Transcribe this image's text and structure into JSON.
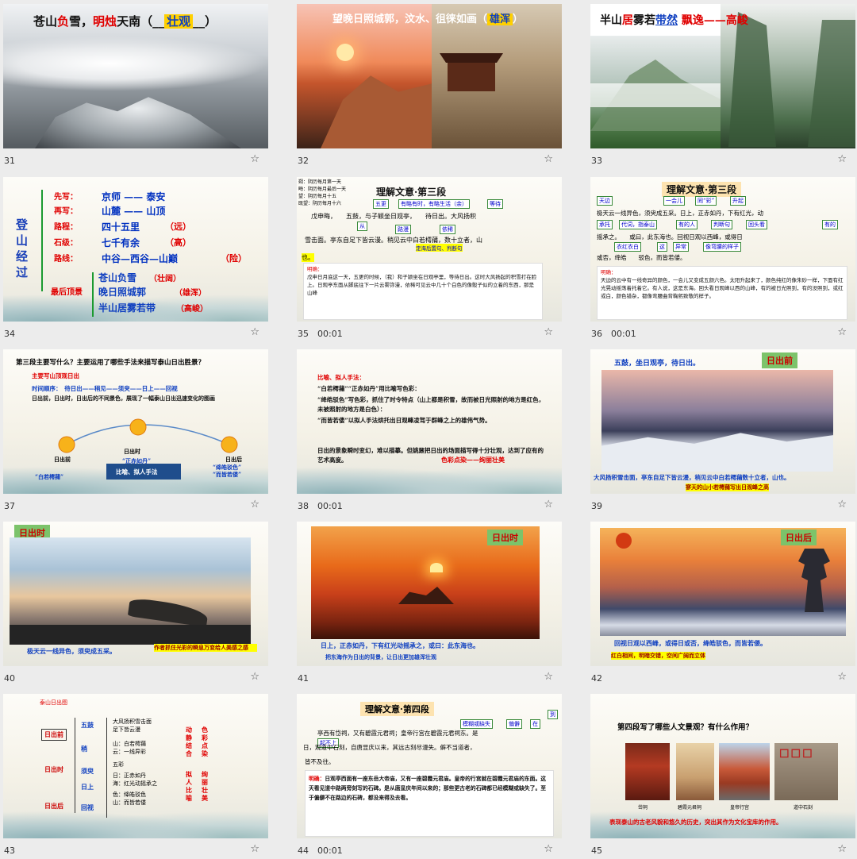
{
  "slides": [
    {
      "num": "31",
      "dur": "",
      "title_pre": "苍山",
      "title_red": "负",
      "title_mid": "雪，",
      "title_red2": "明烛",
      "title_post": "天南（__",
      "title_box": "壮观",
      "title_end": "__）"
    },
    {
      "num": "32",
      "dur": "",
      "title_pre": "望晚日照城郭，汶水、徂徕如画（",
      "title_box": "雄浑",
      "title_end": "）"
    },
    {
      "num": "33",
      "dur": "",
      "title_pre": "半山",
      "title_red": "居",
      "title_mid": "雾若",
      "title_ul": "带然",
      "title_gap": "   ",
      "title_red2": "飘逸——高峻"
    },
    {
      "num": "34",
      "dur": "",
      "side": "登山经过",
      "rows": [
        {
          "label": "先写：",
          "value": "京师 —— 泰安"
        },
        {
          "label": "再写：",
          "value": "山麓 —— 山顶"
        },
        {
          "label": "路程：",
          "value": "四十五里",
          "note": "（远）"
        },
        {
          "label": "石级：",
          "value": "七千有余",
          "note": "（高）"
        },
        {
          "label": "路线：",
          "value": "中谷—西谷—山巅",
          "note": "（险）"
        }
      ],
      "last_label": "最后顶景",
      "scenes": [
        {
          "text": "苍山负雪",
          "note": "（壮阔）"
        },
        {
          "text": "晚日照城郭",
          "note": "（雄浑）"
        },
        {
          "text": "半山居雾若带",
          "note": "（高峻）"
        }
      ]
    },
    {
      "num": "35",
      "dur": "00:01",
      "header": "理解文意·第三段",
      "notes_left": [
        "朔：阴历每月第一天",
        "晦：阴历每月最后一天",
        "望：阴历每月十五",
        "既望：阴历每月十六"
      ],
      "tags": [
        "五更",
        "有略有时，有略生活（余）",
        "等待",
        "从",
        "路漫",
        "依稀"
      ],
      "line1": "戊申晦，　　五鼓，与子颖坐日观亭，　　待日出。大风扬积",
      "line2": "雪击面。亭东自足下皆云漫。稍见云中白若樗蒱，数十立者，山",
      "line2b": "定海后置句、判断句",
      "line3": "也。",
      "expl_label": "明确：",
      "expl": "戊申日月底这一天，五更的时候，（我）和子颖坐在日观亭里，等待日出。这时大风扬起的积雪打在脸上。日观亭东面从脚底往下一片云雾弥漫，依稀可见云中几十个白色的像骰子似的立着的东西，那是山峰"
    },
    {
      "num": "36",
      "dur": "00:01",
      "header": "理解文意·第三段",
      "tags": [
        "天边",
        "一会儿",
        "同“彩”",
        "升起",
        "承托",
        "代词，指泰山",
        "有的人",
        "判断句",
        "回头看",
        "有的",
        "衣红衣白",
        "这",
        "异常",
        "像弯腰的样子"
      ],
      "line1": "极天云一线异色，须臾成五采。日上，正赤如丹，下有红光，动",
      "line2": "摇承之。　　或曰，此东海也。回视日观以西峰，或得日",
      "line3": "或否，绛皓　　驳色，而皆若偻。",
      "expl_label": "明确：",
      "expl": "天边的云中有一线奇异的颜色，一会儿又变成五颜六色。太阳升起来了，颜色纯红的像朱砂一样，下面有红光晃动摇荡着托着它。有人说，这是东海。回头看日观峰以西的山峰，有的被日光照到，有的没照到，或红或白，颜色错杂，都像弯腰曲背鞠躬致敬的样子。"
    },
    {
      "num": "37",
      "dur": "",
      "question": "第三段主要写什么？主要运用了哪些手法来描写泰山日出胜景？",
      "main_red": "主要写山顶观日出",
      "seq": "时间顺序：　待日出——稍见——须臾——日上——回视",
      "summary": "日出前，日出时，日出后的不同景色，展现了一幅泰山日出迅速变化的图画",
      "mid_label": "日出时",
      "mid_quote": "“正赤如丹”",
      "left_label": "日出前",
      "left_quote": "“白若樗蒱”",
      "right_label": "日出后",
      "right_quote": "“绛皓驳色”\n“而皆若偻”",
      "method": "比喻、拟人手法"
    },
    {
      "num": "38",
      "dur": "00:01",
      "title": "比喻、拟人手法：",
      "p1": "“白若樗蒱”“正赤如丹”用比喻写色彩：",
      "p2": "“绛皓驳色”写色彩，抓住了时令特点（山上都是积雪，故而被日光照射的地方是红色，未被照射的地方是白色）：",
      "p3": "“而皆若偻”以拟人手法烘托出日观峰凌驾于群峰之上的雄伟气势。",
      "p4": "日出的景象瞬时变幻，难以描摹。但姚鼐把日出的场面描写得十分壮观，达到了应有的艺术高度。",
      "p4_red": "色彩点染——绚丽壮美"
    },
    {
      "num": "39",
      "dur": "",
      "top": "五鼓，坐日观亭，待日出。",
      "label": "日出前",
      "caption": "大风扬积雪击面，亭东自足下皆云漫，稍见云中白若樗蒱数十立者，山也。",
      "caption2": "寥天的山小若樗蒱写出日观峰之高"
    },
    {
      "num": "40",
      "dur": "",
      "label": "日出时",
      "caption": "极天云一线异色，须臾成五采。",
      "caption2": "作者抓住光彩的瞬息万变给人美感之感"
    },
    {
      "num": "41",
      "dur": "",
      "label": "日出时",
      "caption": "日上，正赤如丹，下有红光动摇承之，或曰：此东海也。",
      "caption2": "把东海作为日出的背景，让日出更加雄浑壮观"
    },
    {
      "num": "42",
      "dur": "",
      "label": "日出后",
      "caption": "回视日观以西峰，或得日或否，绛皓驳色，而皆若偻。",
      "caption2": "红白相间，明暗交错，空间广阔而立体"
    },
    {
      "num": "43",
      "dur": "",
      "title": "泰山日出图",
      "c1": "日出前",
      "c2": "日出时",
      "c3": "日出后",
      "n1": "五鼓",
      "n2": "稍",
      "n3": "须臾",
      "n4": "日上",
      "n5": "回视",
      "items": [
        "大风扬积雪击面",
        "足下皆云漫",
        "山：白若樗蒱",
        "云：一线异彩",
        "五彩",
        "日：正赤如丹",
        "海：红光动摇承之",
        "色：绛皓驳色",
        "山：而皆若偻"
      ],
      "v1": "动静结合",
      "v2": "拟人比喻",
      "v3": "色彩点染",
      "v4": "绚丽壮美"
    },
    {
      "num": "44",
      "dur": "00:01",
      "header": "理解文意·第四段",
      "tags": [
        "模糊或缺失",
        "偏僻",
        "在",
        "到",
        "起不上"
      ],
      "line1": "亭西有岱祠，又有碧霞元君祠；皇帝行宫在碧霞元君祠东。是",
      "line2": "日，观道中石刻，自唐显庆以来，其远古刻尽漫失。僻不当道者，",
      "line3": "皆不及往。",
      "expl_label": "明确：",
      "expl": "日观亭西面有一座东岳大帝庙，又有一座碧霞元君庙。皇帝的行宫就在碧霞元君庙的东面。这天看见道中路两旁刻写的石碑。是从唐显庆年间以来的；那些更古老的石碑都已经模糊或缺失了。至于偏僻不在路边的石碑，都没来得及去看。"
    },
    {
      "num": "45",
      "dur": "",
      "question": "第四段写了哪些人文景观？有什么作用？",
      "pics": [
        "岱祠",
        "碧霞元君祠",
        "皇帝行宫",
        "道中石刻"
      ],
      "answer": "表现泰山的古老风貌和悠久的历史，突出其作为文化宝库的作用。"
    }
  ]
}
